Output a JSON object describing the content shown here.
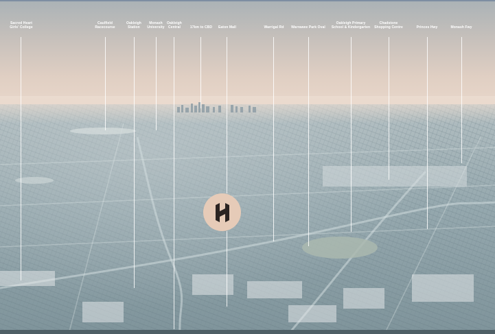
{
  "labels": [
    {
      "id": "sacred-heart",
      "line1": "Sacred Heart",
      "line2": "Girls' College"
    },
    {
      "id": "caulfield",
      "line1": "Caulfield",
      "line2": "Racecourse"
    },
    {
      "id": "oakleigh-station",
      "line1": "Oakleigh",
      "line2": "Station"
    },
    {
      "id": "monash-uni",
      "line1": "Monash",
      "line2": "University"
    },
    {
      "id": "oakleigh-central",
      "line1": "Oakleigh",
      "line2": "Central"
    },
    {
      "id": "cbd",
      "line1": "17km to CBD",
      "line2": ""
    },
    {
      "id": "eaton-mall",
      "line1": "Eaton Mall",
      "line2": ""
    },
    {
      "id": "warrigal",
      "line1": "Warrigal Rd",
      "line2": ""
    },
    {
      "id": "warrawee",
      "line1": "Warrawee Park Oval",
      "line2": ""
    },
    {
      "id": "oakleigh-primary",
      "line1": "Oakleigh Primary",
      "line2": "School & Kindergarten"
    },
    {
      "id": "chadstone",
      "line1": "Chadstone",
      "line2": "Shopping Centre"
    },
    {
      "id": "princes-hwy",
      "line1": "Princes Hwy",
      "line2": ""
    },
    {
      "id": "monash-fwy",
      "line1": "Monash Fwy",
      "line2": ""
    }
  ],
  "logo": {
    "icon": "h-monogram-icon"
  },
  "colors": {
    "sky_top": "#aab2b6",
    "sky_horizon": "#e9d8cb",
    "ground": "#95a8ae",
    "badge": "#e6cbb8",
    "label": "#ffffff"
  }
}
